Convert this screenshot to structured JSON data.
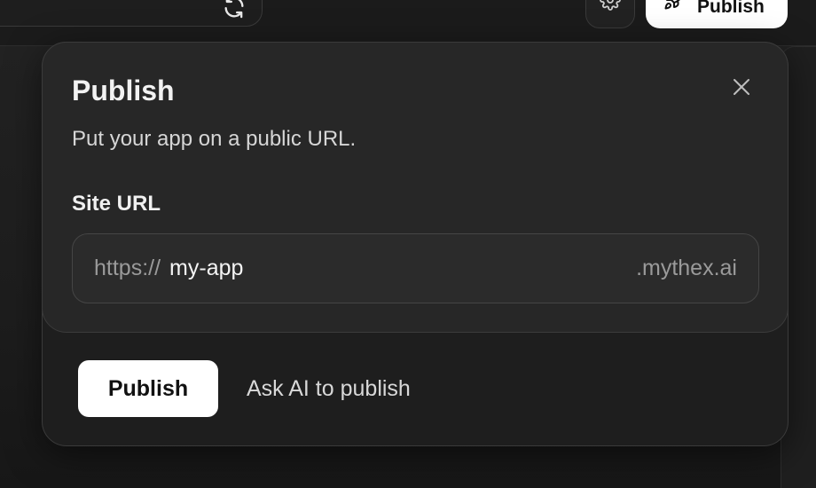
{
  "topbar": {
    "refresh_icon": "refresh-icon",
    "settings_icon": "gear-icon",
    "publish_label": "Publish",
    "publish_icon": "rocket-icon"
  },
  "dialog": {
    "title": "Publish",
    "subtitle": "Put your app on a public URL.",
    "close_icon": "close-icon",
    "field_label": "Site URL",
    "url_prefix": "https://",
    "url_value": "my-app",
    "url_suffix": ".mythex.ai",
    "publish_button": "Publish",
    "ask_ai_link": "Ask AI to publish"
  },
  "colors": {
    "background": "#1b1b1b",
    "panel": "#272727",
    "primary_button": "#ffffff",
    "muted_text": "#9a9a9a"
  }
}
